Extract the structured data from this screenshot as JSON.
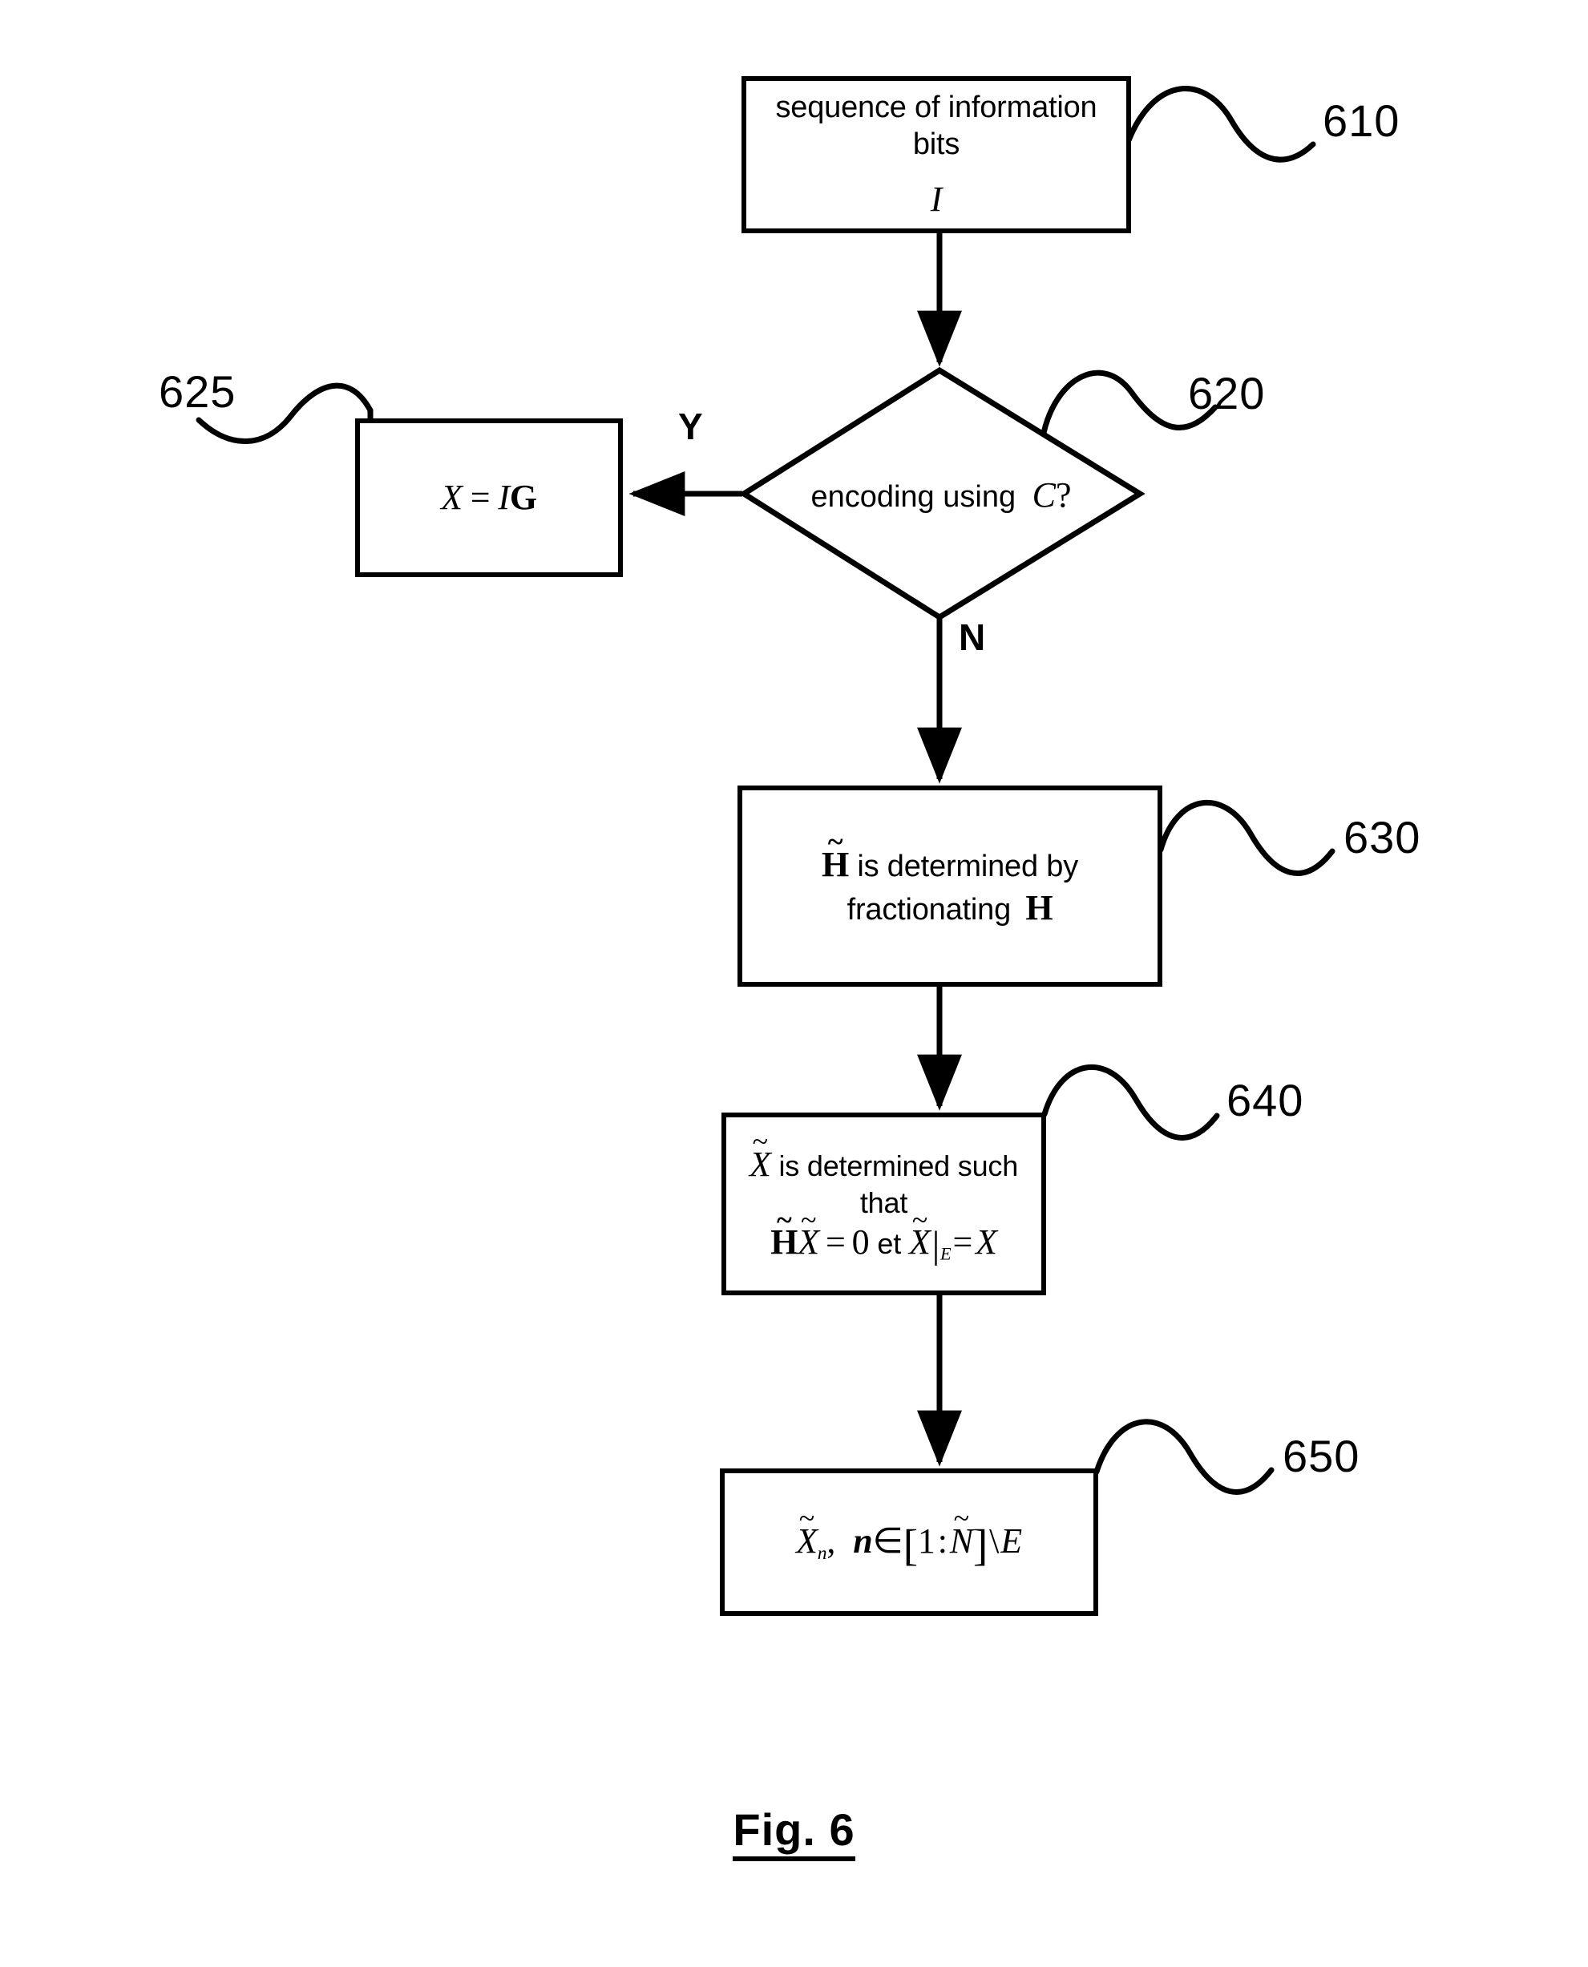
{
  "figure": {
    "caption": "Fig. 6"
  },
  "nodes": {
    "n610": {
      "ref": "610",
      "line1": "sequence of information",
      "line2": "bits",
      "symbol": "I"
    },
    "n620": {
      "ref": "620",
      "text_prefix": "encoding using",
      "symbol": "C",
      "text_suffix": "?"
    },
    "n625": {
      "ref": "625",
      "lhs": "X",
      "eq": "=",
      "rhs_italic": "I",
      "rhs_bold": "G"
    },
    "n630": {
      "ref": "630",
      "matrix_tilde": "H",
      "line1_text": "is determined by",
      "line2_text": "fractionating",
      "matrix_plain": "H"
    },
    "n640": {
      "ref": "640",
      "var_tilde": "X",
      "line1_text": "is determined such that",
      "eq_matrix": "H",
      "eq_var": "X",
      "eq_sign": "=",
      "eq_zero": "0",
      "conj": "et",
      "restrict_var": "X",
      "restrict_sub": "E",
      "restrict_eq": "=",
      "restrict_rhs": "X"
    },
    "n650": {
      "ref": "650",
      "var_tilde": "X",
      "var_sub": "n",
      "comma": ",",
      "index_var": "n",
      "member": "∈",
      "bracket_open": "[",
      "range_start": "1",
      "range_colon": ":",
      "range_end": "N",
      "bracket_close": "]",
      "setminus": "\\",
      "excl_set": "E"
    }
  },
  "branches": {
    "yes": "Y",
    "no": "N"
  },
  "colors": {
    "stroke": "#000000",
    "background": "#ffffff"
  }
}
